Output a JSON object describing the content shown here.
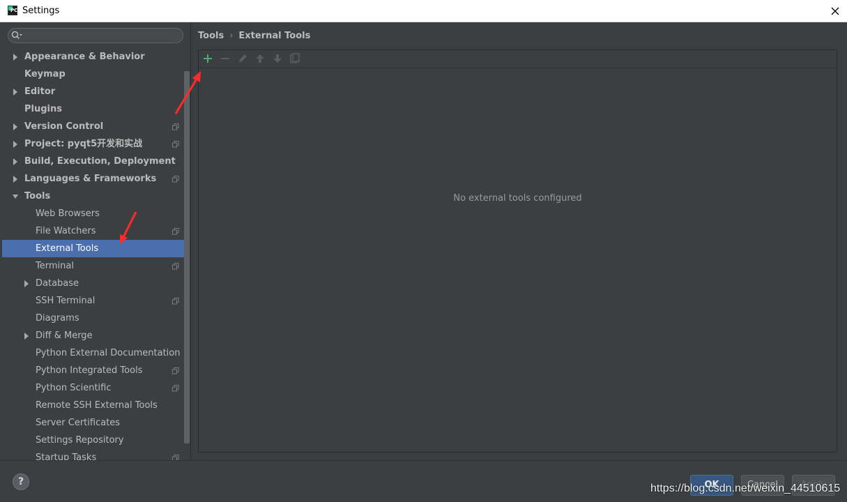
{
  "window": {
    "title": "Settings"
  },
  "search": {
    "placeholder": ""
  },
  "sidebar": {
    "items": [
      {
        "label": "Appearance & Behavior",
        "level": 0,
        "bold": true,
        "arrow": "right",
        "project": false,
        "selected": false
      },
      {
        "label": "Keymap",
        "level": 0,
        "bold": true,
        "arrow": "none",
        "project": false,
        "selected": false
      },
      {
        "label": "Editor",
        "level": 0,
        "bold": true,
        "arrow": "right",
        "project": false,
        "selected": false
      },
      {
        "label": "Plugins",
        "level": 0,
        "bold": true,
        "arrow": "none",
        "project": false,
        "selected": false
      },
      {
        "label": "Version Control",
        "level": 0,
        "bold": true,
        "arrow": "right",
        "project": true,
        "selected": false
      },
      {
        "label": "Project: pyqt5开发和实战",
        "level": 0,
        "bold": true,
        "arrow": "right",
        "project": true,
        "selected": false
      },
      {
        "label": "Build, Execution, Deployment",
        "level": 0,
        "bold": true,
        "arrow": "right",
        "project": false,
        "selected": false
      },
      {
        "label": "Languages & Frameworks",
        "level": 0,
        "bold": true,
        "arrow": "right",
        "project": true,
        "selected": false
      },
      {
        "label": "Tools",
        "level": 0,
        "bold": true,
        "arrow": "down",
        "project": false,
        "selected": false
      },
      {
        "label": "Web Browsers",
        "level": 1,
        "bold": false,
        "arrow": "none",
        "project": false,
        "selected": false
      },
      {
        "label": "File Watchers",
        "level": 1,
        "bold": false,
        "arrow": "none",
        "project": true,
        "selected": false
      },
      {
        "label": "External Tools",
        "level": 1,
        "bold": false,
        "arrow": "none",
        "project": false,
        "selected": true
      },
      {
        "label": "Terminal",
        "level": 1,
        "bold": false,
        "arrow": "none",
        "project": true,
        "selected": false
      },
      {
        "label": "Database",
        "level": 1,
        "bold": false,
        "arrow": "right",
        "project": false,
        "selected": false
      },
      {
        "label": "SSH Terminal",
        "level": 1,
        "bold": false,
        "arrow": "none",
        "project": true,
        "selected": false
      },
      {
        "label": "Diagrams",
        "level": 1,
        "bold": false,
        "arrow": "none",
        "project": false,
        "selected": false
      },
      {
        "label": "Diff & Merge",
        "level": 1,
        "bold": false,
        "arrow": "right",
        "project": false,
        "selected": false
      },
      {
        "label": "Python External Documentation",
        "level": 1,
        "bold": false,
        "arrow": "none",
        "project": false,
        "selected": false
      },
      {
        "label": "Python Integrated Tools",
        "level": 1,
        "bold": false,
        "arrow": "none",
        "project": true,
        "selected": false
      },
      {
        "label": "Python Scientific",
        "level": 1,
        "bold": false,
        "arrow": "none",
        "project": true,
        "selected": false
      },
      {
        "label": "Remote SSH External Tools",
        "level": 1,
        "bold": false,
        "arrow": "none",
        "project": false,
        "selected": false
      },
      {
        "label": "Server Certificates",
        "level": 1,
        "bold": false,
        "arrow": "none",
        "project": false,
        "selected": false
      },
      {
        "label": "Settings Repository",
        "level": 1,
        "bold": false,
        "arrow": "none",
        "project": false,
        "selected": false
      },
      {
        "label": "Startup Tasks",
        "level": 1,
        "bold": false,
        "arrow": "none",
        "project": true,
        "selected": false
      }
    ]
  },
  "breadcrumb": {
    "parent": "Tools",
    "separator": "›",
    "current": "External Tools"
  },
  "toolbar": {
    "buttons": [
      {
        "icon": "add-icon",
        "color": "#59a869",
        "enabled": true
      },
      {
        "icon": "remove-icon",
        "color": "#5a5d5f",
        "enabled": false
      },
      {
        "icon": "edit-icon",
        "color": "#5a5d5f",
        "enabled": false
      },
      {
        "icon": "move-up-icon",
        "color": "#5a5d5f",
        "enabled": false
      },
      {
        "icon": "move-down-icon",
        "color": "#5a5d5f",
        "enabled": false
      },
      {
        "icon": "copy-icon",
        "color": "#5a5d5f",
        "enabled": false
      }
    ]
  },
  "content": {
    "empty_text": "No external tools configured"
  },
  "footer": {
    "help_label": "?",
    "ok_label": "OK",
    "cancel_label": "Cancel",
    "apply_label": "Apply"
  },
  "watermark": "https://blog.csdn.net/weixin_44510615",
  "colors": {
    "accent": "#4b6eaf",
    "background": "#3c3f41",
    "arrow_annotation": "#ff2a2a"
  }
}
